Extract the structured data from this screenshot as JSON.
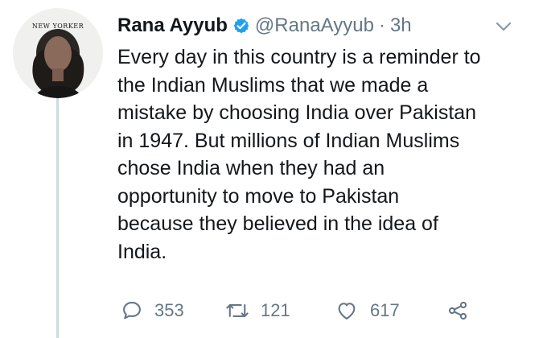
{
  "profile": {
    "avatar_brand": "NEW YORKER"
  },
  "tweet": {
    "display_name": "Rana Ayyub",
    "handle": "@RanaAyyub",
    "separator": "·",
    "time": "3h",
    "text": "Every day in this country is a reminder to\nthe Indian Muslims that we made a\nmistake by choosing India over Pakistan\nin 1947. But millions of Indian Muslims\nchose India when they had an\nopportunity to move to Pakistan\nbecause they believed in the idea of\nIndia."
  },
  "actions": {
    "reply_count": "353",
    "retweet_count": "121",
    "like_count": "617"
  },
  "icons": {
    "verified": "verified-badge-icon",
    "menu": "chevron-down-icon",
    "reply": "reply-icon",
    "retweet": "retweet-icon",
    "like": "heart-icon",
    "share": "share-icon"
  },
  "colors": {
    "text": "#14171a",
    "muted": "#657786",
    "verified": "#1da1f2",
    "thread_line": "#cfd9de"
  }
}
